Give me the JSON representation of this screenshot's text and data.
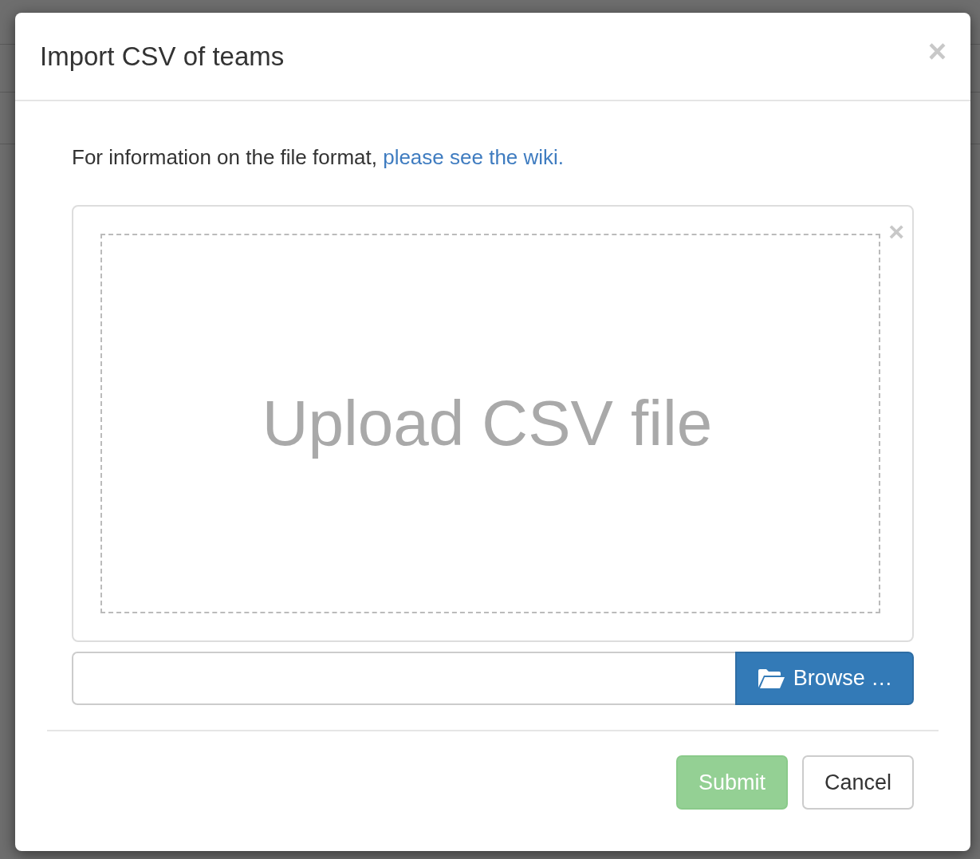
{
  "dialog": {
    "title": "Import CSV of teams",
    "close": "×"
  },
  "info": {
    "text": "For information on the file format, ",
    "link": "please see the wiki."
  },
  "dropzone": {
    "remove": "×",
    "caption": "Upload CSV file"
  },
  "file_input": {
    "button": "Browse …"
  },
  "buttons": [
    {
      "label": "Submit",
      "kind": "primary",
      "disabled": true
    },
    {
      "label": "Cancel",
      "kind": "default",
      "disabled": false
    }
  ]
}
